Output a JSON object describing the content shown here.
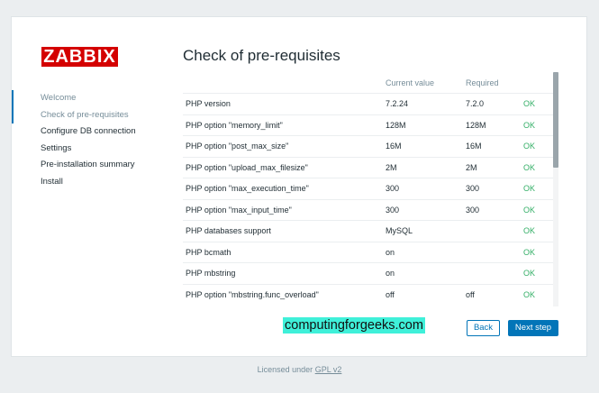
{
  "logo": "ZABBIX",
  "nav": {
    "items": [
      {
        "label": "Welcome",
        "state": "done"
      },
      {
        "label": "Check of pre-requisites",
        "state": "active"
      },
      {
        "label": "Configure DB connection",
        "state": "pending"
      },
      {
        "label": "Settings",
        "state": "pending"
      },
      {
        "label": "Pre-installation summary",
        "state": "pending"
      },
      {
        "label": "Install",
        "state": "pending"
      }
    ]
  },
  "page_title": "Check of pre-requisites",
  "table": {
    "headers": [
      "",
      "Current value",
      "Required",
      ""
    ],
    "rows": [
      [
        "PHP version",
        "7.2.24",
        "7.2.0",
        "OK"
      ],
      [
        "PHP option \"memory_limit\"",
        "128M",
        "128M",
        "OK"
      ],
      [
        "PHP option \"post_max_size\"",
        "16M",
        "16M",
        "OK"
      ],
      [
        "PHP option \"upload_max_filesize\"",
        "2M",
        "2M",
        "OK"
      ],
      [
        "PHP option \"max_execution_time\"",
        "300",
        "300",
        "OK"
      ],
      [
        "PHP option \"max_input_time\"",
        "300",
        "300",
        "OK"
      ],
      [
        "PHP databases support",
        "MySQL",
        "",
        "OK"
      ],
      [
        "PHP bcmath",
        "on",
        "",
        "OK"
      ],
      [
        "PHP mbstring",
        "on",
        "",
        "OK"
      ],
      [
        "PHP option \"mbstring.func_overload\"",
        "off",
        "off",
        "OK"
      ]
    ]
  },
  "watermark": "computingforgeeks.com",
  "buttons": {
    "back": "Back",
    "next": "Next step"
  },
  "footer": {
    "text": "Licensed under",
    "link": "GPL v2"
  },
  "colors": {
    "accent": "#0275b8",
    "ok": "#34af67",
    "logo": "#d40000",
    "background": "#ebeef0"
  }
}
